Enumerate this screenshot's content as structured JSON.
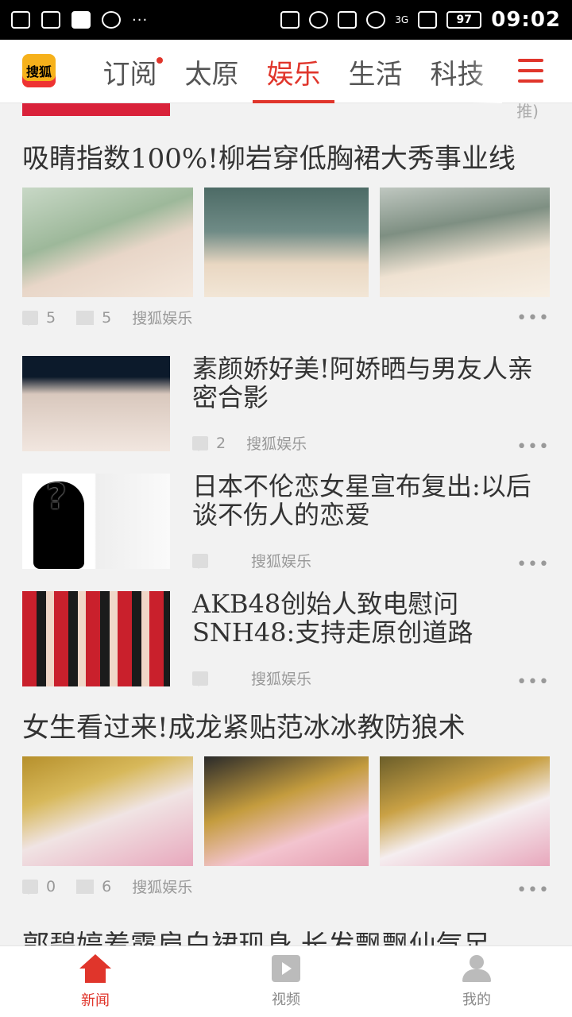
{
  "status": {
    "dots": "···",
    "network": "3G",
    "battery": "97",
    "time": "09:02"
  },
  "header": {
    "logo": "搜狐",
    "tabs": [
      {
        "label": "订阅",
        "badge": true
      },
      {
        "label": "太原"
      },
      {
        "label": "娱乐",
        "active": true
      },
      {
        "label": "生活"
      },
      {
        "label": "科技"
      }
    ],
    "accent_color": "#e0352b"
  },
  "feed": {
    "top_fragment": "推)",
    "articles": [
      {
        "title": "吸睛指数100%!柳岩穿低胸裙大秀事业线",
        "comments": "5",
        "images": "5",
        "source": "搜狐娱乐"
      },
      {
        "title": "素颜娇好美!阿娇晒与男友人亲密合影",
        "comments": "2",
        "source": "搜狐娱乐"
      },
      {
        "title": "日本不伦恋女星宣布复出:以后谈不伤人的恋爱",
        "comments": "",
        "source": "搜狐娱乐"
      },
      {
        "title": "AKB48创始人致电慰问SNH48:支持走原创道路",
        "comments": "",
        "source": "搜狐娱乐"
      },
      {
        "title": "女生看过来!成龙紧贴范冰冰教防狼术",
        "comments": "0",
        "images": "6",
        "source": "搜狐娱乐"
      },
      {
        "title": "郭碧婷着露肩白裙现身 长发飘飘仙气足"
      }
    ]
  },
  "bottom_nav": [
    {
      "label": "新闻",
      "active": true
    },
    {
      "label": "视频"
    },
    {
      "label": "我的"
    }
  ]
}
